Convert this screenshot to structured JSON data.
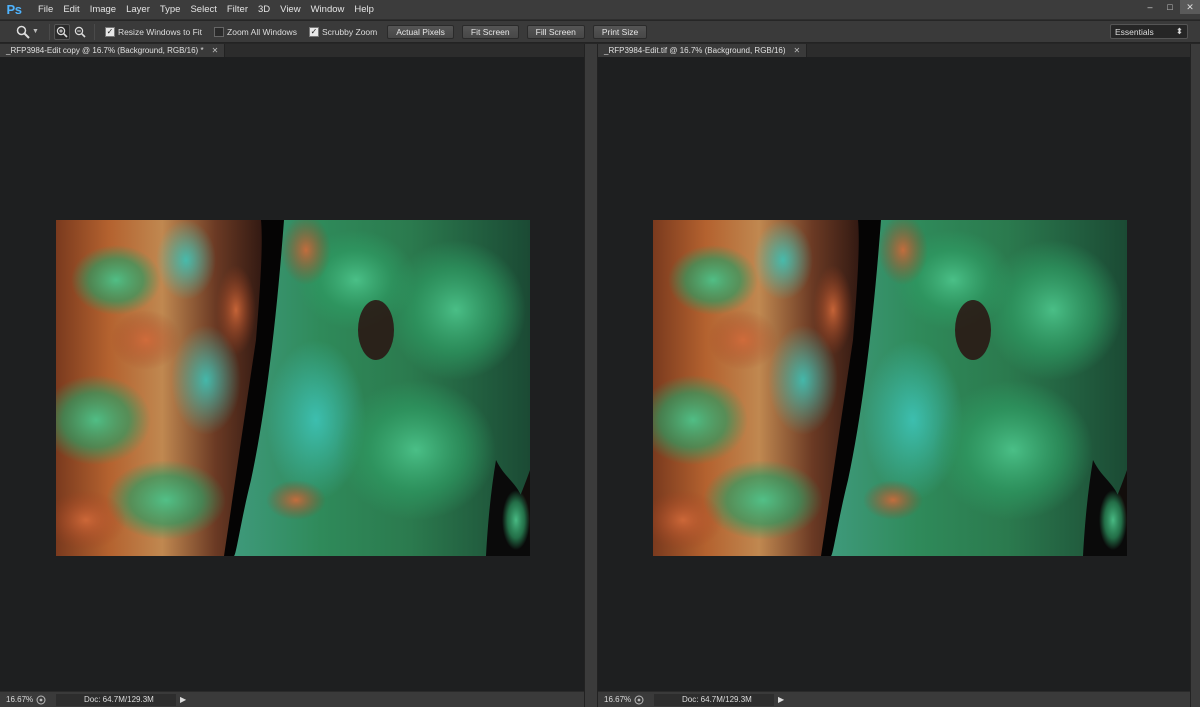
{
  "app": {
    "logo": "Ps"
  },
  "menu": [
    "File",
    "Edit",
    "Image",
    "Layer",
    "Type",
    "Select",
    "Filter",
    "3D",
    "View",
    "Window",
    "Help"
  ],
  "window_controls": {
    "minimize": "–",
    "restore": "□",
    "close": "✕"
  },
  "options": {
    "tool_icon": "zoom-magnifier-icon",
    "resize_windows": {
      "label": "Resize Windows to Fit",
      "checked": true
    },
    "zoom_all": {
      "label": "Zoom All Windows",
      "checked": false
    },
    "scrubby": {
      "label": "Scrubby Zoom",
      "checked": true
    },
    "buttons": {
      "actual": "Actual Pixels",
      "fit": "Fit Screen",
      "fill": "Fill Screen",
      "print": "Print Size"
    },
    "workspace": "Essentials"
  },
  "docs": {
    "left": {
      "tab_title": "_RFP3984-Edit copy @ 16.7% (Background, RGB/16) *",
      "zoom": "16.67%",
      "info": "Doc: 64.7M/129.3M"
    },
    "right": {
      "tab_title": "_RFP3984-Edit.tif @ 16.7% (Background, RGB/16)",
      "zoom": "16.67%",
      "info": "Doc: 64.7M/129.3M"
    }
  },
  "colors": {
    "accent": "#4fb4ff",
    "canvas": "#1e1f20",
    "moss": "#3aa86a",
    "bark": "#b5552a"
  }
}
